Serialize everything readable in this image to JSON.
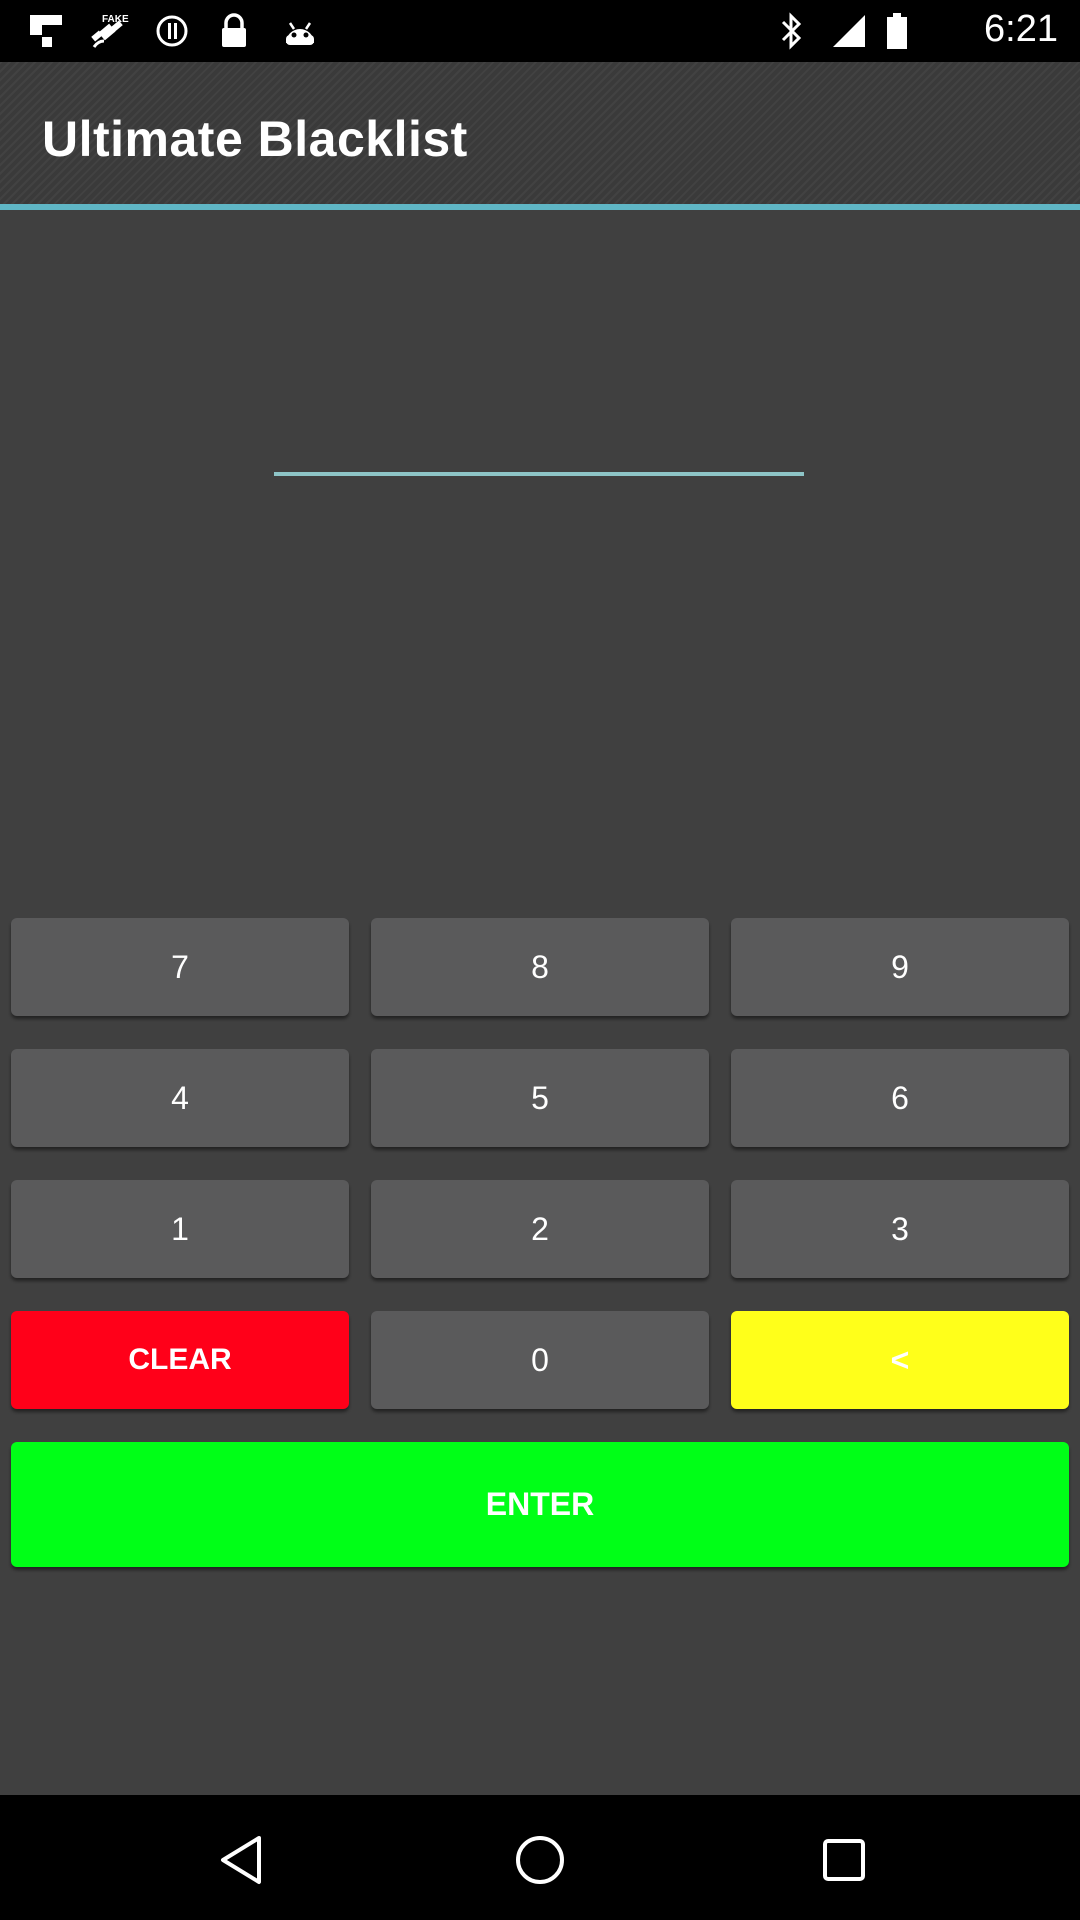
{
  "status_bar": {
    "time": "6:21",
    "icons_left": [
      "flipboard-icon",
      "fake-gps-icon",
      "alert-circle-icon",
      "lock-icon",
      "android-icon"
    ],
    "icons_right": [
      "bluetooth-icon",
      "signal-icon",
      "battery-icon"
    ]
  },
  "action_bar": {
    "title": "Ultimate Blacklist",
    "accent_color": "#5fb6c5"
  },
  "pin_entry": {
    "value": "",
    "underline_color": "#8ec5c7"
  },
  "keypad": {
    "rows": [
      [
        "7",
        "8",
        "9"
      ],
      [
        "4",
        "5",
        "6"
      ],
      [
        "1",
        "2",
        "3"
      ]
    ],
    "clear_label": "CLEAR",
    "zero_label": "0",
    "backspace_label": "<",
    "enter_label": "ENTER",
    "colors": {
      "key": "#5a5a5b",
      "clear": "#ff0019",
      "backspace": "#ffff1a",
      "enter": "#00ff17"
    }
  },
  "nav_bar": {
    "buttons": [
      "back-icon",
      "home-icon",
      "recents-icon"
    ]
  }
}
